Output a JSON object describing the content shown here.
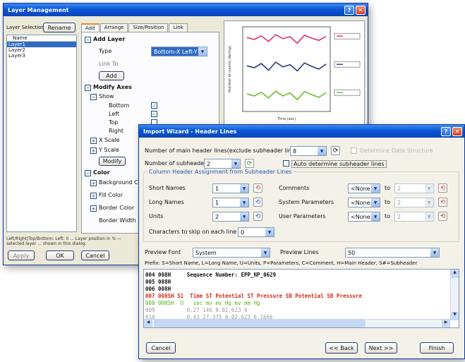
{
  "layer_window": {
    "title": "Layer Management",
    "layer_selection_label": "Layer Selection",
    "rename_label": "Rename",
    "list_header": "Name",
    "layers": [
      "Layer1",
      "Layer2",
      "Layer3"
    ],
    "tabs": [
      "Add",
      "Arrange",
      "Size/Position",
      "Link"
    ],
    "add_layer": {
      "heading": "Add Layer",
      "type_label": "Type",
      "type_value": "Bottom-X Left-Y",
      "link_to_label": "Link To",
      "add_button": "Add"
    },
    "modify_axes": {
      "heading": "Modify Axes",
      "show_label": "Show",
      "items": [
        "Bottom",
        "Left",
        "Top",
        "Right"
      ],
      "x_scale": "X Scale",
      "y_scale": "Y Scale",
      "modify_button": "Modify"
    },
    "color": {
      "heading": "Color",
      "items": [
        "Background Color",
        "Fill Color",
        "Border Color",
        "Border Width"
      ]
    },
    "status_text": "Left/Right/Top/Bottom: Left: 0 ... Layer position in % — selected layer ... shown in this dialog.",
    "buttons": {
      "apply": "Apply",
      "ok": "OK",
      "cancel": "Cancel"
    }
  },
  "chart_data": {
    "type": "line",
    "xlabel": "Time (sec)",
    "ylabel": "Number of counts (ds/mg)",
    "ylim": [
      0,
      3
    ],
    "series": [
      {
        "color": "#e0307a",
        "values": [
          2.62,
          2.55,
          2.68,
          2.48,
          2.72,
          2.58,
          2.65,
          2.42,
          2.7,
          2.6,
          2.52,
          2.66
        ]
      },
      {
        "color": "#2c3a7a",
        "values": [
          1.62,
          1.55,
          1.7,
          1.46,
          1.75,
          1.58,
          1.66,
          1.44,
          1.72,
          1.6,
          1.5,
          1.68
        ]
      },
      {
        "color": "#6cc02a",
        "values": [
          0.62,
          0.55,
          0.68,
          0.48,
          0.72,
          0.55,
          0.66,
          0.42,
          0.7,
          0.6,
          0.5,
          0.66
        ]
      }
    ]
  },
  "wizard": {
    "title": "Import Wizard - Header Lines",
    "main_header_label": "Number of main header lines(exclude subheader lines)",
    "main_header_value": "8",
    "subheader_label": "Number of subheader lines",
    "subheader_value": "2",
    "auto_determine_label": "Auto determine subheader lines",
    "unreadable_label": "Determine Data Structure",
    "group_label": "Column Header Assignment from Subheader Lines",
    "rows": [
      {
        "label": "Short Names",
        "value": "1"
      },
      {
        "label": "Long Names",
        "value": "1"
      },
      {
        "label": "Units",
        "value": "2"
      }
    ],
    "right_rows": [
      {
        "label": "Comments",
        "value": "<None>",
        "to": "to",
        "to_value": "2"
      },
      {
        "label": "System Parameters",
        "value": "<None>",
        "to": "to",
        "to_value": "2"
      },
      {
        "label": "User Parameters",
        "value": "<None>",
        "to": "to",
        "to_value": "2"
      }
    ],
    "chars_label": "Characters to skip on each line",
    "chars_value": "0",
    "preview_font_label": "Preview Font",
    "preview_font_value": "System",
    "preview_lines_label": "Preview Lines",
    "preview_lines_value": "50",
    "prefix_text": "Prefix: S=Short Name, L=Long Name, U=Units, P=Parameters, C=Comment, H=Main Header, S#=Subheader",
    "preview_lines": [
      {
        "prefix": "004 008H",
        "text": "Sequence Number: EPP_NP_0629"
      },
      {
        "prefix": "005 008H",
        "text": ""
      },
      {
        "prefix": "006 008H",
        "text": ""
      },
      {
        "prefix": "007 008SH S1",
        "text": "Time ST Potential ST Pressure SB Potential SB Pressure"
      },
      {
        "prefix": "008 008SH  U",
        "text": "sec mv mv Hg mv mm Hg"
      },
      {
        "prefix": "009",
        "text": "0.27 146 0.02.623 6"
      },
      {
        "prefix": "010",
        "text": "0.43 27.375 0.02.623 6.1666"
      }
    ],
    "buttons": {
      "cancel": "Cancel",
      "back": "<< Back",
      "next": "Next >>",
      "finish": "Finish"
    }
  }
}
